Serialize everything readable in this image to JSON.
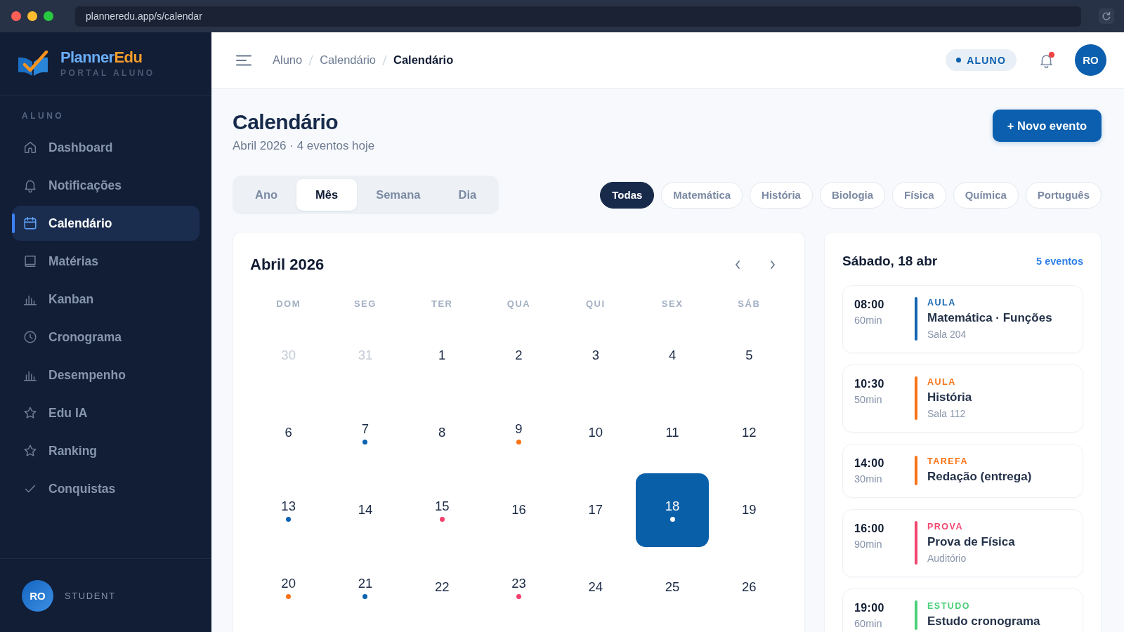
{
  "browser": {
    "url": "planneredu.app/s/calendar"
  },
  "sidebar": {
    "brand": [
      {
        "text": "Planner",
        "color": "#6aaef7"
      },
      {
        "text": "Edu",
        "color": "#f59e2c"
      }
    ],
    "tagline": "PORTAL ALUNO",
    "section": "ALUNO",
    "items": [
      {
        "label": "Dashboard",
        "kind": "home",
        "selected": false
      },
      {
        "label": "Notificações",
        "kind": "bell",
        "selected": false
      },
      {
        "label": "Calendário",
        "kind": "calendar",
        "selected": true
      },
      {
        "label": "Matérias",
        "kind": "book",
        "selected": false
      },
      {
        "label": "Kanban",
        "kind": "chart",
        "selected": false
      },
      {
        "label": "Cronograma",
        "kind": "clock",
        "selected": false
      },
      {
        "label": "Desempenho",
        "kind": "chart",
        "selected": false
      },
      {
        "label": "Edu IA",
        "kind": "star",
        "selected": false
      },
      {
        "label": "Ranking",
        "kind": "star",
        "selected": false
      },
      {
        "label": "Conquistas",
        "kind": "check",
        "selected": false
      }
    ],
    "user": {
      "initials": "RO",
      "role": "STUDENT"
    }
  },
  "header": {
    "breadcrumbs": [
      {
        "label": "Aluno",
        "current": false
      },
      {
        "label": "Calendário",
        "current": false
      },
      {
        "label": "Calendário",
        "current": true
      }
    ],
    "role": "ALUNO",
    "unread": true,
    "initials": "RO"
  },
  "page": {
    "title": "Calendário",
    "subtitle": "Abril 2026 · 4 eventos hoje",
    "action": "+ Novo evento"
  },
  "views": [
    {
      "label": "Ano",
      "selected": false
    },
    {
      "label": "Mês",
      "selected": true
    },
    {
      "label": "Semana",
      "selected": false
    },
    {
      "label": "Dia",
      "selected": false
    }
  ],
  "filters": [
    {
      "label": "Todas",
      "selected": true
    },
    {
      "label": "Matemática",
      "selected": false
    },
    {
      "label": "História",
      "selected": false
    },
    {
      "label": "Biologia",
      "selected": false
    },
    {
      "label": "Física",
      "selected": false
    },
    {
      "label": "Química",
      "selected": false
    },
    {
      "label": "Português",
      "selected": false
    }
  ],
  "calendar": {
    "title": "Abril 2026",
    "weekdays": [
      "DOM",
      "SEG",
      "TER",
      "QUA",
      "QUI",
      "SEX",
      "SÁB"
    ],
    "weeks": [
      [
        {
          "day": "30",
          "outside": true,
          "selected": false
        },
        {
          "day": "31",
          "outside": true,
          "selected": false
        },
        {
          "day": "1",
          "outside": false,
          "selected": false
        },
        {
          "day": "2",
          "outside": false,
          "selected": false
        },
        {
          "day": "3",
          "outside": false,
          "selected": false
        },
        {
          "day": "4",
          "outside": false,
          "selected": false
        },
        {
          "day": "5",
          "outside": false,
          "selected": false
        }
      ],
      [
        {
          "day": "6",
          "outside": false,
          "selected": false
        },
        {
          "day": "7",
          "outside": false,
          "selected": false,
          "color": "#0b63b0"
        },
        {
          "day": "8",
          "outside": false,
          "selected": false
        },
        {
          "day": "9",
          "outside": false,
          "selected": false,
          "color": "#f97316"
        },
        {
          "day": "10",
          "outside": false,
          "selected": false
        },
        {
          "day": "11",
          "outside": false,
          "selected": false
        },
        {
          "day": "12",
          "outside": false,
          "selected": false
        }
      ],
      [
        {
          "day": "13",
          "outside": false,
          "selected": false,
          "color": "#0b63b0"
        },
        {
          "day": "14",
          "outside": false,
          "selected": false
        },
        {
          "day": "15",
          "outside": false,
          "selected": false,
          "color": "#f43f6e"
        },
        {
          "day": "16",
          "outside": false,
          "selected": false
        },
        {
          "day": "17",
          "outside": false,
          "selected": false
        },
        {
          "day": "18",
          "outside": false,
          "selected": true,
          "color": "#ffffff"
        },
        {
          "day": "19",
          "outside": false,
          "selected": false
        }
      ],
      [
        {
          "day": "20",
          "outside": false,
          "selected": false,
          "color": "#f97316"
        },
        {
          "day": "21",
          "outside": false,
          "selected": false,
          "color": "#0b63b0"
        },
        {
          "day": "22",
          "outside": false,
          "selected": false
        },
        {
          "day": "23",
          "outside": false,
          "selected": false,
          "color": "#f43f6e"
        },
        {
          "day": "24",
          "outside": false,
          "selected": false
        },
        {
          "day": "25",
          "outside": false,
          "selected": false
        },
        {
          "day": "26",
          "outside": false,
          "selected": false
        }
      ]
    ]
  },
  "agenda": {
    "title": "Sábado, 18 abr",
    "count": "5 eventos",
    "events": [
      {
        "time": "08:00",
        "duration": "60min",
        "type": "AULA",
        "title": "Matemática · Funções",
        "location": "Sala 204",
        "color": "#1565b0"
      },
      {
        "time": "10:30",
        "duration": "50min",
        "type": "AULA",
        "title": "História",
        "location": "Sala 112",
        "color": "#f97316"
      },
      {
        "time": "14:00",
        "duration": "30min",
        "type": "TAREFA",
        "title": "Redação (entrega)",
        "color": "#f97316"
      },
      {
        "time": "16:00",
        "duration": "90min",
        "type": "PROVA",
        "title": "Prova de Física",
        "location": "Auditório",
        "color": "#f0466e"
      },
      {
        "time": "19:00",
        "duration": "60min",
        "type": "ESTUDO",
        "title": "Estudo cronograma",
        "color": "#4ccf7a"
      }
    ]
  }
}
